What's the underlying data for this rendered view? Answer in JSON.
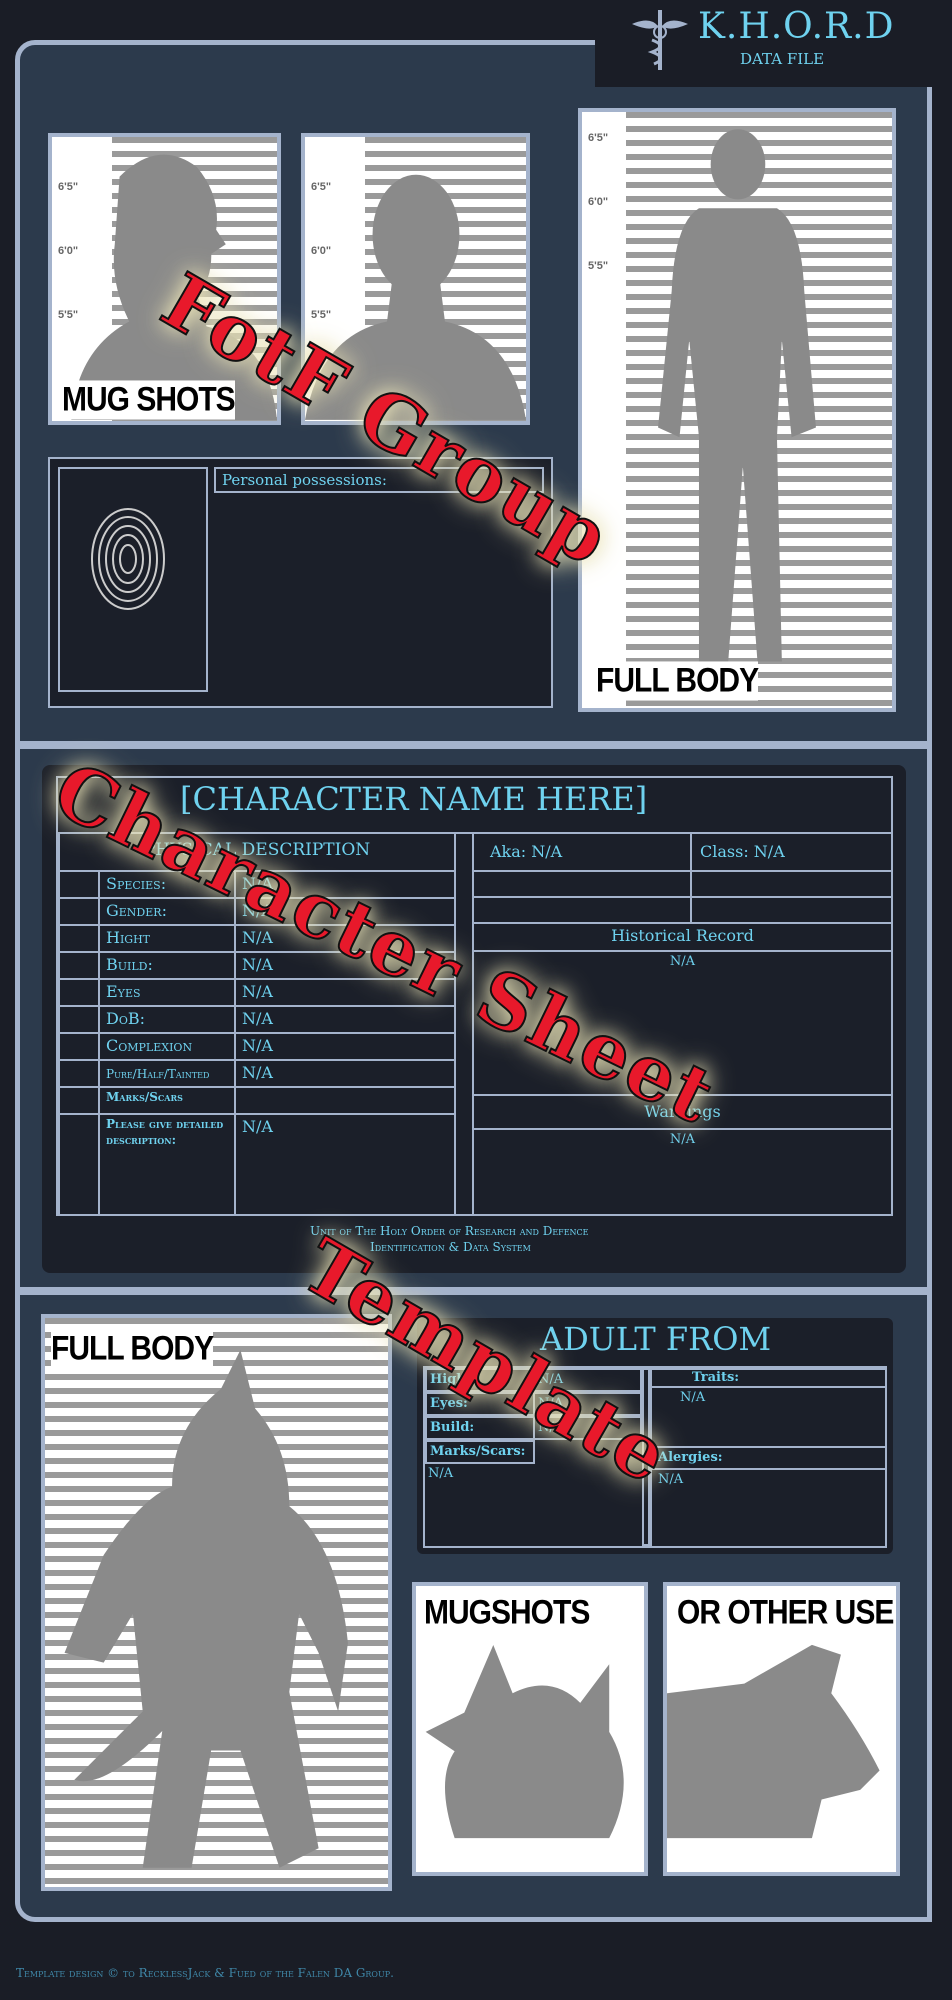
{
  "header": {
    "brand": "K.H.O.R.D",
    "subtitle": "DATA FILE",
    "logo_icon": "caduceus-icon"
  },
  "top": {
    "mugshot_label": "MUG SHOTS",
    "height_ticks": [
      "6'5\"",
      "6'0\"",
      "5'5\""
    ],
    "full_body_label": "FULL BODY",
    "possessions_label": "Personal possessions:",
    "fingerprint_icon": "fingerprint-icon"
  },
  "sheet": {
    "name": "[CHARACTER NAME HERE]",
    "physical_header": "PHYSICAL DESCRIPTION",
    "rows": [
      {
        "label": "Species:",
        "value": "N/A"
      },
      {
        "label": "Gender:",
        "value": "N/A"
      },
      {
        "label": "Hight",
        "value": "N/A"
      },
      {
        "label": "Build:",
        "value": "N/A"
      },
      {
        "label": "Eyes",
        "value": "N/A"
      },
      {
        "label": "DoB:",
        "value": "N/A"
      },
      {
        "label": "Complexion",
        "value": "N/A"
      },
      {
        "label": "Pure/Half/Tainted",
        "value": "N/A"
      },
      {
        "label": "Marks/Scars",
        "value": ""
      },
      {
        "label": "Please give detailed description:",
        "value": "N/A"
      }
    ],
    "aka": "Aka: N/A",
    "class": "Class: N/A",
    "history_header": "Historical Record",
    "history_value": "N/A",
    "warnings_header": "Warnings",
    "warnings_value": "N/A",
    "footer_line1": "Unit of The Holy Order of Research and Defence",
    "footer_line2": "Identification & Data System"
  },
  "bottom": {
    "full_body_label": "FULL BODY",
    "adult_title": "ADULT FROM",
    "left_rows": [
      {
        "label": "Hight:",
        "value": "N/A"
      },
      {
        "label": "Eyes:",
        "value": "N/A"
      },
      {
        "label": "Build:",
        "value": "N/A"
      }
    ],
    "marks_label": "Marks/Scars:",
    "marks_value": "N/A",
    "traits_label": "Traits:",
    "traits_value": "N/A",
    "allergies_label": "Alergies:",
    "allergies_value": "N/A",
    "mugshots_label": "MUGSHOTS",
    "other_label": "OR OTHER USE"
  },
  "footer": "Template design © to RecklessJack & Fued of the Falen DA Group.",
  "watermarks": [
    "FotF Group",
    "Character Sheet",
    "Template"
  ],
  "colors": {
    "accent": "#6fd2ef",
    "frame": "#a4b3cc",
    "watermark": "#e8192b",
    "background": "#1a1d26"
  }
}
